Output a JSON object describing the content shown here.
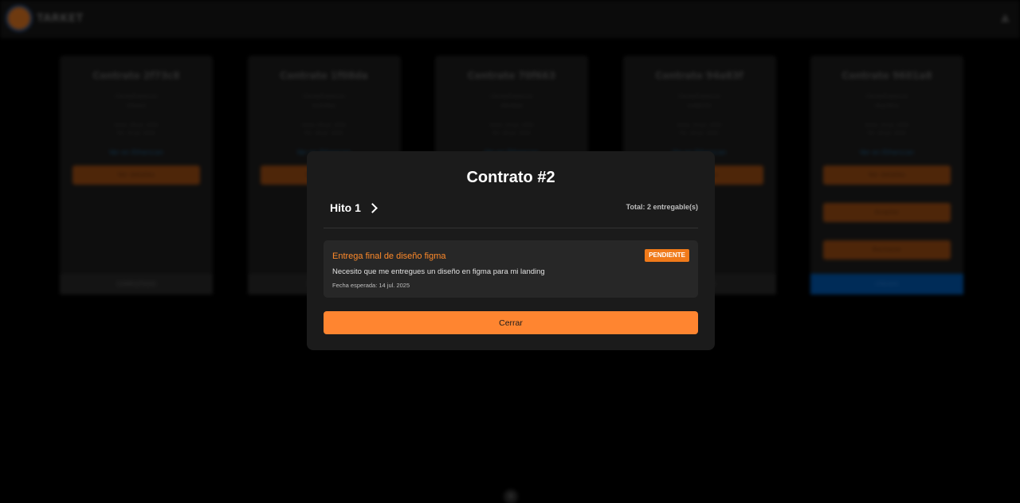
{
  "app": {
    "brand": "TARKET",
    "icons": {
      "logo": "logo-mark",
      "user": "user-icon",
      "scroll": "chevron-down-icon"
    }
  },
  "cards": [
    {
      "title": "Contrato 2f73c8",
      "label": "Cliente/Freelancer",
      "id": "5f3ee43",
      "start": "Inicio: 09 jul. 2025",
      "end": "Fin: 15 jul. 2025",
      "link": "Ver en Etherscan",
      "actions": [
        "Ver detalles"
      ],
      "status": "COMPLETADO",
      "status_color": "#262626"
    },
    {
      "title": "Contrato 1f08da",
      "label": "Cliente/Freelancer",
      "id": "0c4549ea",
      "start": "Inicio: 09 jul. 2025",
      "end": "Fin: 18 jul. 2025",
      "link": "Ver en Etherscan",
      "actions": [
        "Ver detalles"
      ],
      "status": "PENDIENTE",
      "status_color": "#262626"
    },
    {
      "title": "Contrato 70f663",
      "label": "Cliente/Freelancer",
      "id": "4f6e9bde",
      "start": "Inicio: 10 jul. 2025",
      "end": "Fin: 20 jul. 2025",
      "link": "Ver en Etherscan",
      "actions": [
        "Ver detalles"
      ],
      "status": "PENDIENTE",
      "status_color": "#262626"
    },
    {
      "title": "Contrato 94a83f",
      "label": "Cliente/Freelancer",
      "id": "5a48d730",
      "start": "Inicio: 10 jul. 2025",
      "end": "Fin: 20 jul. 2025",
      "link": "Ver en Etherscan",
      "actions": [
        "Ver detalles"
      ],
      "status": "PENDIENTE",
      "status_color": "#262626"
    },
    {
      "title": "Contrato 9601a8",
      "label": "Cliente/Freelancer",
      "id": "0ba2097a",
      "start": "Inicio: 10 jul. 2025",
      "end": "Fin: 20 jul. 2025",
      "link": "Ver en Etherscan",
      "actions": [
        "Ver detalles",
        "Aceptar",
        "Rechazar"
      ],
      "status": "CREADO",
      "status_color": "#0050a0"
    }
  ],
  "modal": {
    "title": "Contrato #2",
    "milestone": "Hito 1",
    "total": "Total: 2 entregable(s)",
    "deliverable": {
      "title": "Entrega final de diseño figma",
      "badge": "PENDIENTE",
      "description": "Necesito que me entregues un diseño en figma para mi landing",
      "date": "Fecha esperada: 14 jul. 2025"
    },
    "close_label": "Cerrar",
    "accent": "#ff8530"
  }
}
